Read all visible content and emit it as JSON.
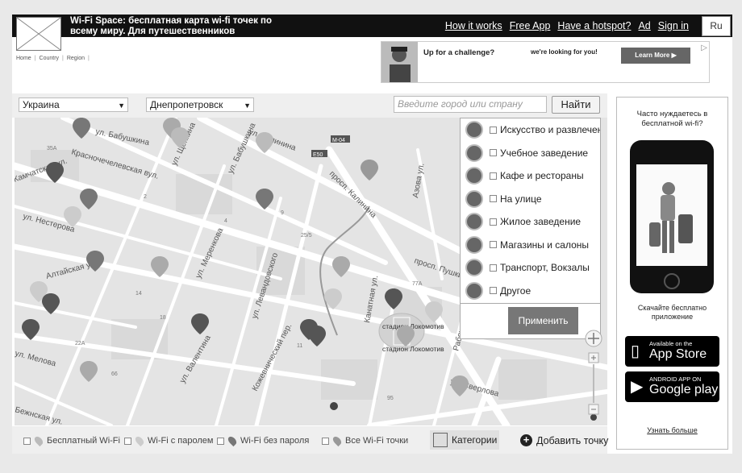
{
  "header": {
    "site_title": "Wi-Fi Space: бесплатная карта wi-fi точек по всему миру. Для путешественников",
    "nav": [
      "How it works",
      "Free App",
      "Have a hotspot?",
      "Ad",
      "Sign in"
    ],
    "language": "Ru"
  },
  "breadcrumb": [
    "Home",
    "Country",
    "Region"
  ],
  "ad": {
    "headline": "Up for a challenge?",
    "subline": "we're looking for you!",
    "cta": "Learn More ▶",
    "icon": "adchoices-icon"
  },
  "filters": {
    "country": "Украина",
    "city": "Днепропетровск",
    "search_placeholder": "Введите город или страну",
    "search_button": "Найти"
  },
  "map": {
    "street_labels": [
      "ул. Бабушкина",
      "ул. Калинина",
      "Красночечелевская вул.",
      "Камчатская ул.",
      "ул. Нестерова",
      "Алтайская ул.",
      "ул. Щепкина",
      "ул. Бабушкина",
      "просп. Калинина",
      "ул. Меренкова",
      "ул. Левандовского",
      "Канатная ул.",
      "просп. Пушкина",
      "Рабочая ул.",
      "ул. Сверлова",
      "ул. Валентина",
      "ул. Мелова",
      "Кожевнический пер.",
      "Бежнская ул.",
      "Азова ул."
    ],
    "building_numbers": [
      "35A",
      "2",
      "4",
      "9",
      "25/5",
      "77A",
      "22A",
      "11",
      "14",
      "18",
      "66",
      "95",
      "M-04",
      "E50"
    ],
    "poi": "стадион Локомотив",
    "poi_sub": "стадион Локомотив"
  },
  "categories": {
    "items": [
      {
        "label": "Искусство и развлечения",
        "icon": "masks-icon"
      },
      {
        "label": "Учебное заведение",
        "icon": "graduation-cap-icon"
      },
      {
        "label": "Кафе и рестораны",
        "icon": "cutlery-icon"
      },
      {
        "label": "На улице",
        "icon": "tree-icon"
      },
      {
        "label": "Жилое заведение",
        "icon": "house-icon"
      },
      {
        "label": "Магазины и салоны",
        "icon": "shopping-cart-icon"
      },
      {
        "label": "Транспорт, Вокзалы",
        "icon": "bus-icon"
      },
      {
        "label": "Другое",
        "icon": "dots-icon"
      }
    ],
    "apply": "Применить"
  },
  "bottom": {
    "legend": [
      "Бесплатный Wi-Fi",
      "Wi-Fi с паролем",
      "Wi-Fi без пароля",
      "Все Wi-Fi точки"
    ],
    "categories_toggle": "Категории",
    "add_point": "Добавить точку"
  },
  "sidebar": {
    "question": "Часто нуждаетесь в бесплатной wi-fi?",
    "download": "Скачайте бесплатно приложение",
    "appstore_small": "Available on the",
    "appstore_big": "App Store",
    "gplay_small": "ANDROID APP ON",
    "gplay_big": "Google play",
    "more": "Узнать больше"
  }
}
